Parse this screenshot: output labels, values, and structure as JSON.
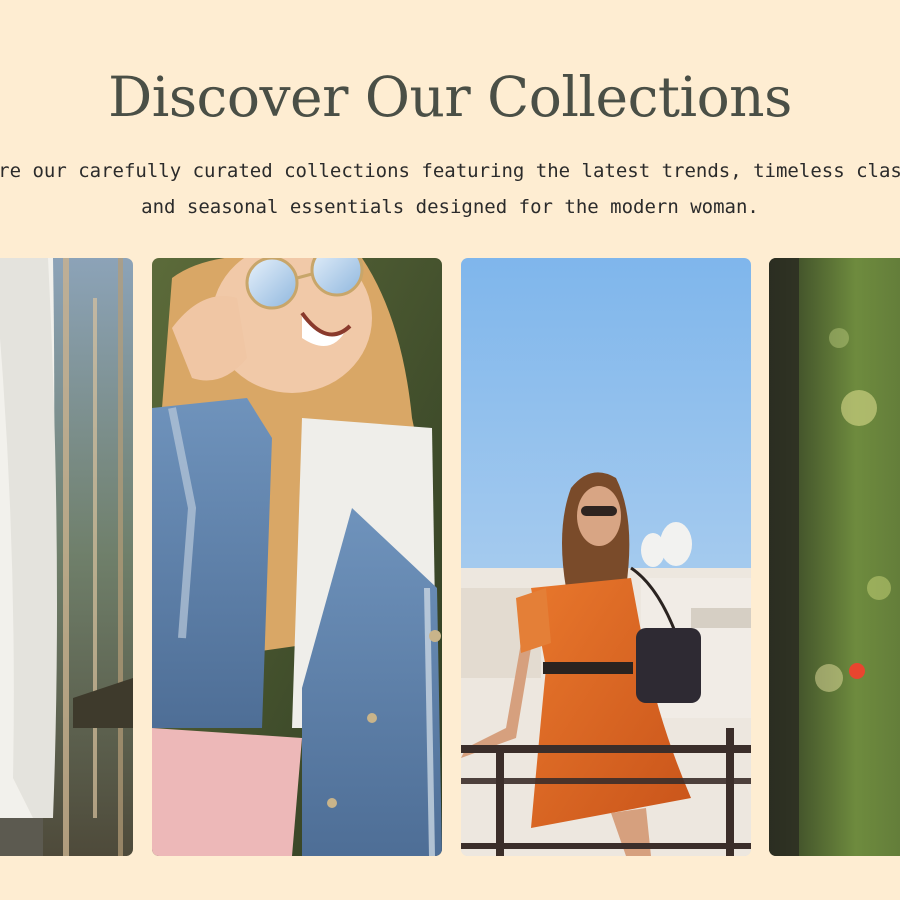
{
  "hero": {
    "title": "Discover Our Collections",
    "subtitle_line1": "Explore our carefully curated collections featuring the latest trends, timeless classics,",
    "subtitle_line2": "and seasonal essentials designed for the modern woman."
  },
  "carousel": {
    "cards": [
      {
        "image": "woman-in-white-knit-sweater-among-trees"
      },
      {
        "image": "laughing-woman-with-sunglasses-and-denim-jacket"
      },
      {
        "image": "woman-in-orange-dress-leaning-on-balcony-railing"
      },
      {
        "image": "blurred-green-trees-bokeh"
      }
    ]
  },
  "colors": {
    "background": "#FEEDD2",
    "title": "#4A4F46",
    "text": "#2B2B2B"
  }
}
